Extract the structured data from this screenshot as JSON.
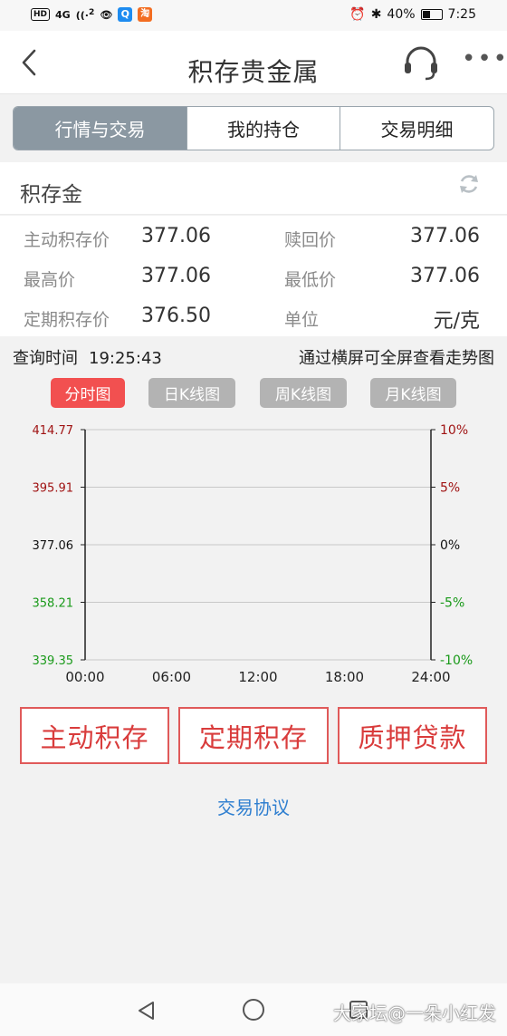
{
  "status_bar": {
    "network_badge": "HD",
    "network_type": "4G",
    "wifi_sup": "2",
    "app_icon_1": "Q",
    "app_icon_2": "淘",
    "battery": "40%",
    "time": "7:25"
  },
  "header": {
    "title": "积存贵金属",
    "more_label": "•••"
  },
  "tabs": [
    {
      "label": "行情与交易",
      "active": true
    },
    {
      "label": "我的持仓",
      "active": false
    },
    {
      "label": "交易明细",
      "active": false
    }
  ],
  "product": {
    "name": "积存金",
    "rows": [
      {
        "label1": "主动积存价",
        "value1": "377.06",
        "label2": "赎回价",
        "value2": "377.06"
      },
      {
        "label1": "最高价",
        "value1": "377.06",
        "label2": "最低价",
        "value2": "377.06"
      },
      {
        "label1": "定期积存价",
        "value1": "376.50",
        "label2": "单位",
        "value2": "元/克"
      }
    ]
  },
  "query": {
    "label": "查询时间",
    "time": "19:25:43",
    "hint": "通过横屏可全屏查看走势图"
  },
  "chart_buttons": [
    {
      "label": "分时图",
      "active": true
    },
    {
      "label": "日K线图",
      "active": false
    },
    {
      "label": "周K线图",
      "active": false
    },
    {
      "label": "月K线图",
      "active": false
    }
  ],
  "chart_data": {
    "type": "line",
    "x_ticks": [
      "00:00",
      "06:00",
      "12:00",
      "18:00",
      "24:00"
    ],
    "y_left_ticks": [
      "414.77",
      "395.91",
      "377.06",
      "358.21",
      "339.35"
    ],
    "y_right_ticks": [
      "10%",
      "5%",
      "0%",
      "-5%",
      "-10%"
    ],
    "ylim": [
      339.35,
      414.77
    ],
    "grid": true,
    "series": [],
    "colors": {
      "up": "#a01414",
      "neutral": "#111111",
      "down": "#1a9a1a"
    }
  },
  "actions": [
    {
      "label": "主动积存"
    },
    {
      "label": "定期积存"
    },
    {
      "label": "质押贷款"
    }
  ],
  "agreement_link": "交易协议",
  "watermark": "大家坛@一朵小红发"
}
